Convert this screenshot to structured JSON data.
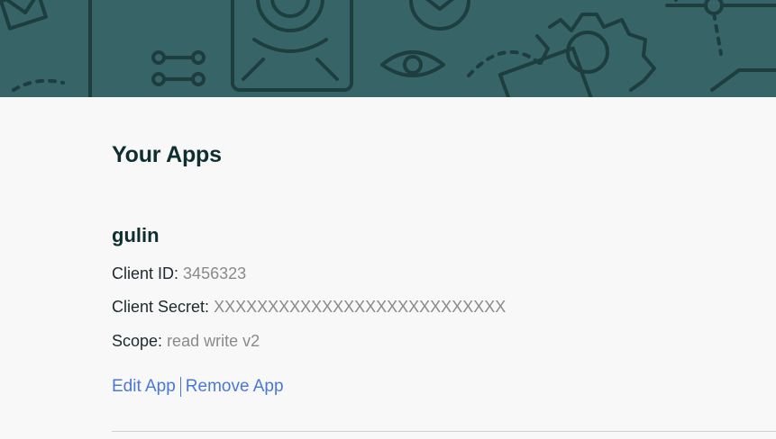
{
  "banner": {
    "background_color": "#376466",
    "line_color": "#1e3d3f"
  },
  "page": {
    "title": "Your Apps"
  },
  "apps": [
    {
      "name": "gulin",
      "fields": [
        {
          "label": "Client ID:",
          "value": "3456323"
        },
        {
          "label": "Client Secret:",
          "value": "XXXXXXXXXXXXXXXXXXXXXXXXXXX"
        },
        {
          "label": "Scope:",
          "value": "read write v2"
        }
      ],
      "actions": {
        "edit": "Edit App",
        "remove": "Remove App"
      }
    }
  ],
  "colors": {
    "heading": "#0f2e30",
    "link": "#4a78d8",
    "muted": "#8a8a8a"
  }
}
